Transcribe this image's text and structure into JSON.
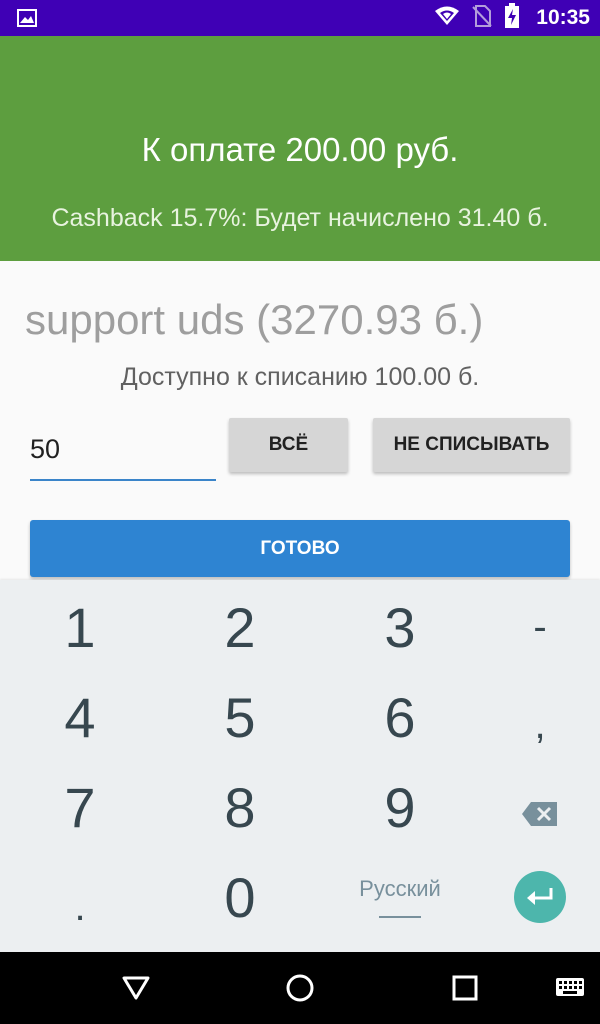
{
  "status_bar": {
    "time": "10:35",
    "icons": [
      "image-icon",
      "wifi-icon",
      "no-sim-icon",
      "battery-charging-icon"
    ]
  },
  "header": {
    "title": "К оплате 200.00 руб.",
    "cashback": "Cashback 15.7%: Будет начислено 31.40 б."
  },
  "account": {
    "name": "support uds (3270.93 б.)",
    "available": "Доступно к списанию 100.00 б."
  },
  "form": {
    "amount_value": "50",
    "all_label": "ВСЁ",
    "none_label": "НЕ СПИСЫВАТЬ",
    "done_label": "ГОТОВО"
  },
  "keyboard": {
    "keys": {
      "k1": "1",
      "k2": "2",
      "k3": "3",
      "minus": "-",
      "k4": "4",
      "k5": "5",
      "k6": "6",
      "comma": ",",
      "k7": "7",
      "k8": "8",
      "k9": "9",
      "dot": ".",
      "k0": "0"
    },
    "language": "Русский",
    "icons": [
      "backspace-icon",
      "enter-icon"
    ]
  },
  "nav_bar": {
    "icons": [
      "back-icon",
      "home-icon",
      "recents-icon",
      "keyboard-switch-icon"
    ]
  },
  "colors": {
    "status_bar": "#3f00b5",
    "header": "#5d9e3f",
    "primary_button": "#2e84d2",
    "enter_key": "#4db6ac"
  }
}
